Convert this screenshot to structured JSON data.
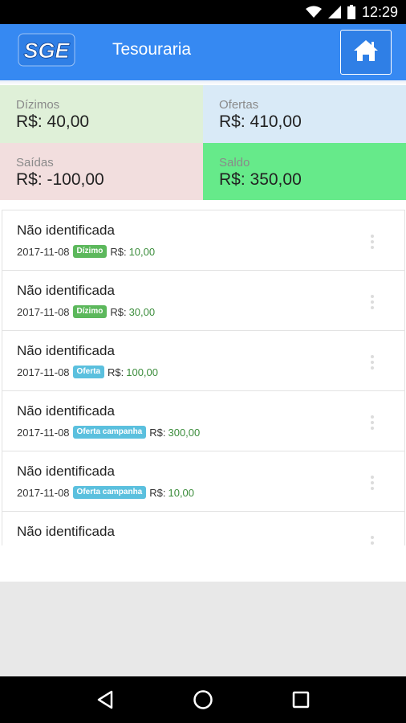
{
  "status_bar": {
    "time": "12:29",
    "icons": [
      "wifi-icon",
      "signal-icon",
      "battery-icon"
    ]
  },
  "app_bar": {
    "logo_text": "SGE",
    "title": "Tesouraria",
    "home_icon": "home-icon"
  },
  "summary": {
    "dizimos": {
      "label": "Dízimos",
      "value": "R$: 40,00"
    },
    "ofertas": {
      "label": "Ofertas",
      "value": "R$: 410,00"
    },
    "saidas": {
      "label": "Saídas",
      "value": "R$: -100,00"
    },
    "saldo": {
      "label": "Saldo",
      "value": "R$: 350,00"
    }
  },
  "transactions": [
    {
      "name": "Não identificada",
      "date": "2017-11-08",
      "badge": "Dízimo",
      "badge_type": "dizimo",
      "currency": "R$:",
      "amount": "10,00"
    },
    {
      "name": "Não identificada",
      "date": "2017-11-08",
      "badge": "Dízimo",
      "badge_type": "dizimo",
      "currency": "R$:",
      "amount": "30,00"
    },
    {
      "name": "Não identificada",
      "date": "2017-11-08",
      "badge": "Oferta",
      "badge_type": "oferta",
      "currency": "R$:",
      "amount": "100,00"
    },
    {
      "name": "Não identificada",
      "date": "2017-11-08",
      "badge": "Oferta campanha",
      "badge_type": "oferta",
      "currency": "R$:",
      "amount": "300,00"
    },
    {
      "name": "Não identificada",
      "date": "2017-11-08",
      "badge": "Oferta campanha",
      "badge_type": "oferta",
      "currency": "R$:",
      "amount": "10,00"
    },
    {
      "name": "Não identificada",
      "date": "",
      "badge": "",
      "badge_type": "",
      "currency": "",
      "amount": ""
    }
  ],
  "colors": {
    "app_bar": "#3689f2",
    "dizimos_bg": "#dff0d8",
    "ofertas_bg": "#d9eaf7",
    "saidas_bg": "#f2dede",
    "saldo_bg": "#66ea8a",
    "badge_dizimo": "#5cb85c",
    "badge_oferta": "#5bc0de",
    "amount": "#3c8d3c"
  },
  "nav_bar": {
    "icons": [
      "back-icon",
      "home-circle-icon",
      "recents-icon"
    ]
  }
}
